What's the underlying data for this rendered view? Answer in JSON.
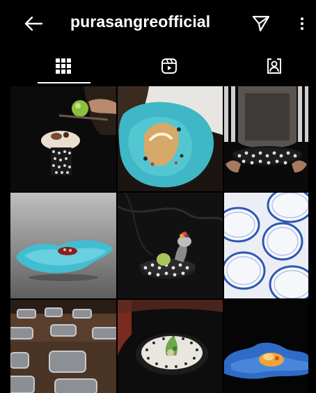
{
  "header": {
    "username": "purasangreofficial",
    "back_icon": "arrow-left-icon",
    "send_icon": "paper-plane-icon",
    "more_icon": "more-vertical-icon"
  },
  "tabs": [
    {
      "icon": "grid-icon",
      "active": true
    },
    {
      "icon": "reels-icon",
      "active": false
    },
    {
      "icon": "tagged-icon",
      "active": false
    }
  ],
  "posts": [
    {
      "subject": "dessert on black cylinder stand, hand with tongs holding green sphere"
    },
    {
      "subject": "chef holding turquoise plate with grilled fish"
    },
    {
      "subject": "person in apron holding black dotted bowl"
    },
    {
      "subject": "blue glass plate with red dish on grey background"
    },
    {
      "subject": "black dotted vessel with dessert and flower on marble"
    },
    {
      "subject": "white plates with blue rims, top view"
    },
    {
      "subject": "metal bowls on wooden table"
    },
    {
      "subject": "white dotted plate with garnished dish"
    },
    {
      "subject": "blue textured plate with orange food"
    }
  ],
  "colors": {
    "background": "#000000",
    "text": "#ffffff",
    "turquoise": "#3fb7c6",
    "blue": "#2d57b4"
  }
}
